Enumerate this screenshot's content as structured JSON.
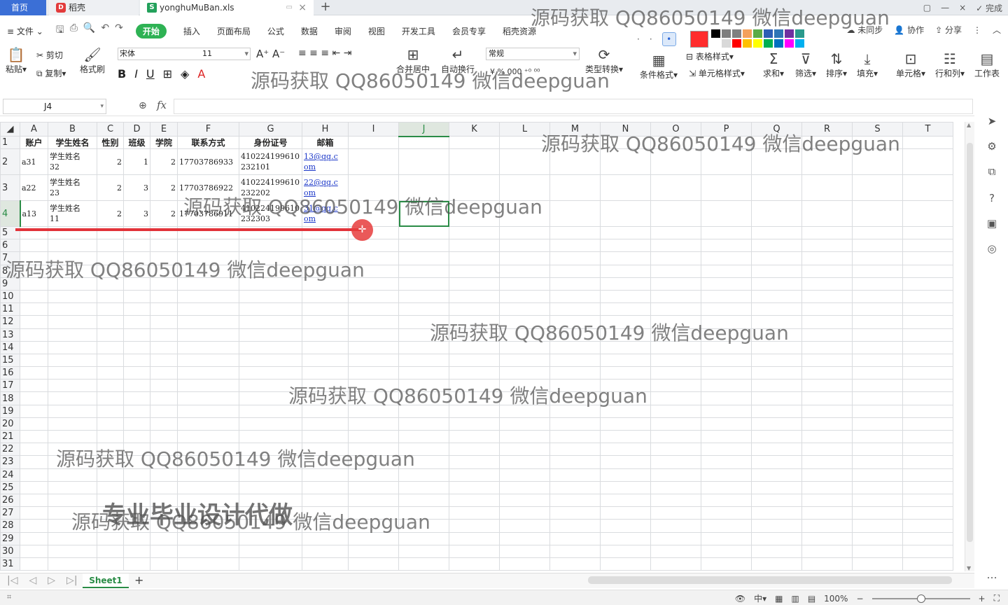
{
  "tabs": {
    "home": "首页",
    "daoke": "稻壳",
    "file": "yonghuMuBan.xls",
    "add": "+"
  },
  "title_right": {
    "done": "✓ 完成"
  },
  "ribbon_tabs": [
    "文件",
    "开始",
    "插入",
    "页面布局",
    "公式",
    "数据",
    "审阅",
    "视图",
    "开发工具",
    "会员专享",
    "稻壳资源"
  ],
  "ribbon_active": "开始",
  "ribbon_right": [
    "未同步",
    "协作",
    "分享"
  ],
  "toolbar": {
    "paste": "粘贴",
    "cut": "剪切",
    "copy": "复制",
    "format_painter": "格式刷",
    "font_name": "宋体",
    "font_size": "11",
    "number_format": "常规",
    "merge": "合并居中",
    "wrap": "自动换行",
    "convert": "类型转换",
    "table_style": "表格样式",
    "cond_format": "条件格式",
    "cell_style": "单元格样式",
    "sum": "求和",
    "filter": "筛选",
    "sort": "排序",
    "fill": "填充",
    "cells": "单元格",
    "rowcol": "行和列",
    "worksheet": "工作表"
  },
  "palette": [
    "#000000",
    "#7f7f7f",
    "#808080",
    "#f4a15b",
    "#5aab47",
    "#2d5fb5",
    "#2e75b6",
    "#7030a0",
    "#2a9a8c",
    "#ffffff",
    "#d9d9d9",
    "#ff0000",
    "#ffc000",
    "#ffff00",
    "#00b050",
    "#0070c0",
    "#ff00ff",
    "#00b0f0"
  ],
  "formula": {
    "name_box": "J4",
    "fx": "fx",
    "value": ""
  },
  "columns": [
    "A",
    "B",
    "C",
    "D",
    "E",
    "F",
    "G",
    "H",
    "I",
    "J",
    "K",
    "L",
    "M",
    "N",
    "O",
    "P",
    "Q",
    "R",
    "S",
    "T"
  ],
  "selected_column": "J",
  "selected_row": 4,
  "rows": [
    {
      "n": "1",
      "cells": [
        "账户",
        "学生姓名",
        "性别",
        "班级",
        "学院",
        "联系方式",
        "身份证号",
        "邮箱"
      ]
    },
    {
      "n": "2",
      "cells": [
        "a31",
        "学生姓名\n32",
        "2",
        "1",
        "2",
        "17703786933",
        "410224199610\n232101",
        "13@qq.c\nom"
      ]
    },
    {
      "n": "3",
      "cells": [
        "a22",
        "学生姓名\n23",
        "2",
        "3",
        "2",
        "17703786922",
        "410224199610\n232202",
        "22@qq.c\nom"
      ]
    },
    {
      "n": "4",
      "cells": [
        "a13",
        "学生姓名\n11",
        "2",
        "3",
        "2",
        "17703786911",
        "410224199610\n232303",
        "31@qq.c\nom"
      ]
    }
  ],
  "empty_rows": [
    "5",
    "6",
    "7",
    "8",
    "9",
    "10",
    "11",
    "12",
    "13",
    "14",
    "15",
    "16",
    "17",
    "18",
    "19",
    "20",
    "21",
    "22",
    "23",
    "24",
    "25",
    "26",
    "27",
    "28",
    "29",
    "30",
    "31"
  ],
  "sheet": {
    "tab": "Sheet1",
    "add": "+"
  },
  "status": {
    "zoom": "100%"
  },
  "watermarks": [
    "源码获取 QQ86050149 微信deepguan",
    "源码获取 QQ86050149 微信deepguan",
    "源码获取 QQ86050149 微信deepguan",
    "源码获取 QQ86050149 微信deepguan",
    "源码获取 QQ86050149 微信deepguan",
    "源码获取 QQ86050149 微信deepguan",
    "源码获取 QQ86050149 微信deepguan",
    "源码获取 QQ86050149 微信deepguan",
    "源码获取 QQ86050149 微信deepguan"
  ],
  "watermark_big": "专业毕业设计代做"
}
